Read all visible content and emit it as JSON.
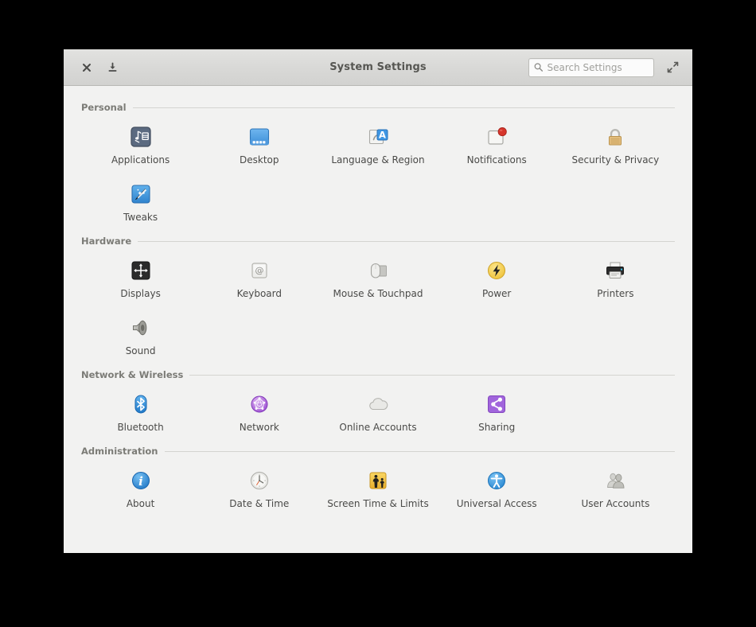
{
  "window": {
    "title": "System Settings",
    "close_tooltip": "Close",
    "download_tooltip": "Download",
    "maximize_tooltip": "Maximize"
  },
  "search": {
    "placeholder": "Search Settings",
    "value": ""
  },
  "sections": [
    {
      "title": "Personal",
      "items": [
        {
          "label": "Applications",
          "icon": "applications-icon"
        },
        {
          "label": "Desktop",
          "icon": "desktop-icon"
        },
        {
          "label": "Language & Region",
          "icon": "language-region-icon"
        },
        {
          "label": "Notifications",
          "icon": "notifications-icon"
        },
        {
          "label": "Security & Privacy",
          "icon": "security-privacy-icon"
        },
        {
          "label": "Tweaks",
          "icon": "tweaks-icon"
        }
      ]
    },
    {
      "title": "Hardware",
      "items": [
        {
          "label": "Displays",
          "icon": "displays-icon"
        },
        {
          "label": "Keyboard",
          "icon": "keyboard-icon"
        },
        {
          "label": "Mouse & Touchpad",
          "icon": "mouse-touchpad-icon"
        },
        {
          "label": "Power",
          "icon": "power-icon"
        },
        {
          "label": "Printers",
          "icon": "printers-icon"
        },
        {
          "label": "Sound",
          "icon": "sound-icon"
        }
      ]
    },
    {
      "title": "Network & Wireless",
      "items": [
        {
          "label": "Bluetooth",
          "icon": "bluetooth-icon"
        },
        {
          "label": "Network",
          "icon": "network-icon"
        },
        {
          "label": "Online Accounts",
          "icon": "online-accounts-icon"
        },
        {
          "label": "Sharing",
          "icon": "sharing-icon"
        }
      ]
    },
    {
      "title": "Administration",
      "items": [
        {
          "label": "About",
          "icon": "about-icon"
        },
        {
          "label": "Date & Time",
          "icon": "date-time-icon"
        },
        {
          "label": "Screen Time & Limits",
          "icon": "screen-time-icon"
        },
        {
          "label": "Universal Access",
          "icon": "universal-access-icon"
        },
        {
          "label": "User Accounts",
          "icon": "user-accounts-icon"
        }
      ]
    }
  ],
  "colors": {
    "desktop_background": "#000000",
    "window_background": "#f2f2f1",
    "titlebar_background": "#d9d9d7",
    "section_header_text": "#7b7b76",
    "label_text": "#4a4a48",
    "notification_badge": "#d6352b",
    "power_accent": "#f5cf3d",
    "bluetooth_accent": "#2f96e8",
    "network_accent": "#b069d8",
    "sharing_accent": "#9b63d8",
    "about_accent": "#2f8fdd",
    "screen_time_accent": "#f2c63f",
    "universal_access_accent": "#3d9ce0",
    "language_accent": "#3f97e4",
    "security_accent": "#e0b871"
  }
}
